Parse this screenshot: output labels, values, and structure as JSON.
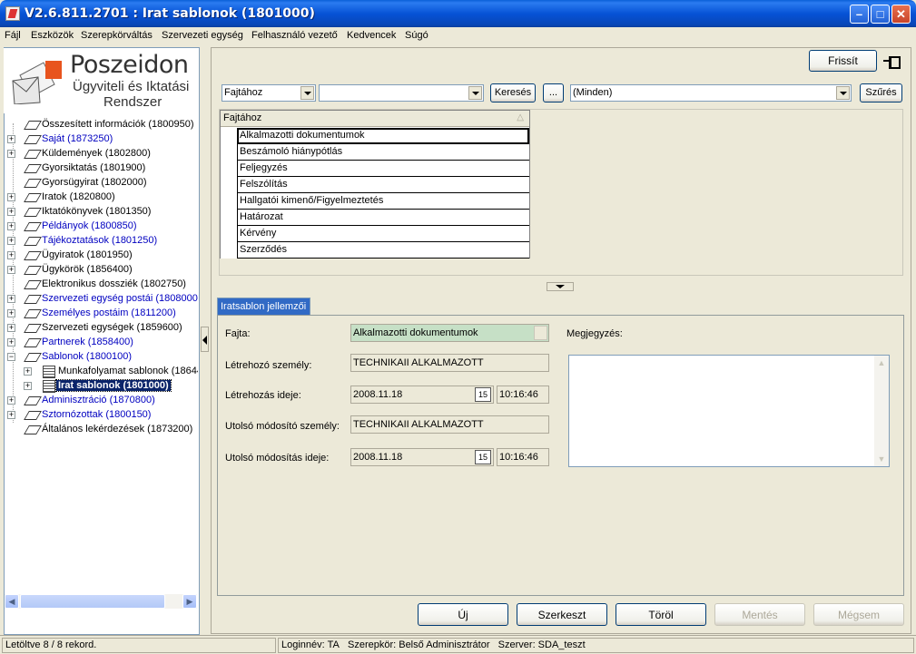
{
  "window": {
    "title": "V2.6.811.2701 : Irat sablonok (1801000)"
  },
  "menu": [
    "Fájl",
    "Eszközök",
    "Szerepkörváltás",
    "Szervezeti egység",
    "Felhasználó vezető",
    "Kedvencek",
    "Súgó"
  ],
  "logo": {
    "name": "Poszeidon",
    "line2": "Ügyviteli és Iktatási",
    "line3": "Rendszer"
  },
  "tree": [
    {
      "label": "Összesített információk (1800950)",
      "expandable": false,
      "blue": false
    },
    {
      "label": "Saját (1873250)",
      "expandable": true,
      "blue": true
    },
    {
      "label": "Küldemények (1802800)",
      "expandable": true,
      "blue": false
    },
    {
      "label": "Gyorsiktatás (1801900)",
      "expandable": false,
      "blue": false
    },
    {
      "label": "Gyorsügyirat (1802000)",
      "expandable": false,
      "blue": false
    },
    {
      "label": "Iratok (1820800)",
      "expandable": true,
      "blue": false
    },
    {
      "label": "Iktatókönyvek (1801350)",
      "expandable": true,
      "blue": false
    },
    {
      "label": "Példányok (1800850)",
      "expandable": true,
      "blue": true
    },
    {
      "label": "Tájékoztatások (1801250)",
      "expandable": true,
      "blue": true
    },
    {
      "label": "Ügyiratok (1801950)",
      "expandable": true,
      "blue": false
    },
    {
      "label": "Ügykörök (1856400)",
      "expandable": true,
      "blue": false
    },
    {
      "label": "Elektronikus dossziék (1802750)",
      "expandable": false,
      "blue": false
    },
    {
      "label": "Szervezeti egység postái (1808000)",
      "expandable": true,
      "blue": true
    },
    {
      "label": "Személyes postáim (1811200)",
      "expandable": true,
      "blue": true
    },
    {
      "label": "Szervezeti egységek (1859600)",
      "expandable": true,
      "blue": false
    },
    {
      "label": "Partnerek (1858400)",
      "expandable": true,
      "blue": true
    },
    {
      "label": "Sablonok (1800100)",
      "expandable": true,
      "expanded": true,
      "blue": true
    },
    {
      "label": "Munkafolyamat sablonok (18644",
      "expandable": true,
      "child": true,
      "blue": false
    },
    {
      "label": "Irat sablonok (1801000)",
      "expandable": true,
      "child": true,
      "selected": true
    },
    {
      "label": "Adminisztráció (1870800)",
      "expandable": true,
      "blue": true
    },
    {
      "label": "Sztornózottak (1800150)",
      "expandable": true,
      "blue": true
    },
    {
      "label": "Általános lekérdezések (1873200)",
      "expandable": false,
      "blue": false
    }
  ],
  "toolbar": {
    "refresh": "Frissít",
    "group_combo": "Fajtához",
    "search_combo": "",
    "search_btn": "Keresés",
    "ellipsis_btn": "...",
    "filter_combo": "(Minden)",
    "filter_btn": "Szűrés"
  },
  "grid": {
    "header": "Fajtához",
    "rows": [
      "Alkalmazotti dokumentumok",
      "Beszámoló hiánypótlás",
      "Feljegyzés",
      "Felszólítás",
      "Hallgatói kimenő/Figyelmeztetés",
      "Határozat",
      "Kérvény",
      "Szerződés"
    ]
  },
  "details": {
    "tab": "Iratsablon jellemzői",
    "type_label": "Fajta:",
    "type_value": "Alkalmazotti dokumentumok",
    "note_label": "Megjegyzés:",
    "creator_label": "Létrehozó személy:",
    "creator_value": "TECHNIKAII ALKALMAZOTT",
    "created_label": "Létrehozás ideje:",
    "created_date": "2008.11.18",
    "created_time": "10:16:46",
    "modifier_label": "Utolsó módosító személy:",
    "modifier_value": "TECHNIKAII ALKALMAZOTT",
    "modified_label": "Utolsó módosítás ideje:",
    "modified_date": "2008.11.18",
    "modified_time": "10:16:46",
    "calendar_glyph": "15"
  },
  "actions": {
    "new": "Új",
    "edit": "Szerkeszt",
    "delete": "Töröl",
    "save": "Mentés",
    "cancel": "Mégsem"
  },
  "status": {
    "records": "Letöltve 8 / 8 rekord.",
    "login": "Loginnév: TA",
    "role": "Szerepkör: Belső Adminisztrátor",
    "server": "Szerver: SDA_teszt"
  },
  "colors": {
    "titlebar": "#0653d6",
    "selection": "#0a246a",
    "tab": "#316ac5",
    "tree_link": "#0000c0",
    "type_field": "#c6e0c6"
  }
}
